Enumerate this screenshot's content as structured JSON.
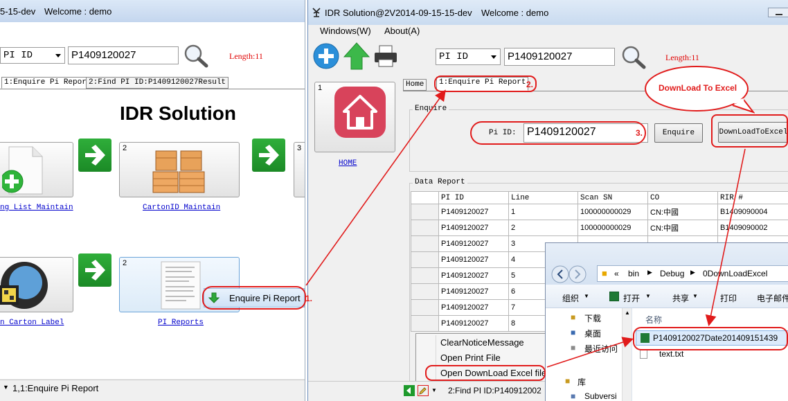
{
  "left_window": {
    "title_fragment": "5-15-dev",
    "welcome": "Welcome : demo",
    "combo_value": "PI ID",
    "pi_input_value": "P1409120027",
    "length_label": "Length:11",
    "tabs": [
      "1:Enquire Pi Report",
      "2:Find PI ID:P1409120027Result"
    ],
    "heading": "IDR Solution",
    "tile_numbers": [
      "2",
      "3",
      "2"
    ],
    "tile_links": [
      "ng List Maintain",
      "CartonID Maintain",
      "n Carton Label",
      "PI Reports"
    ],
    "popup_label": "Enquire Pi Report",
    "status_text": "1,1:Enquire Pi Report"
  },
  "right_window": {
    "title": "IDR Solution@2V2014-09-15-15-dev",
    "welcome": "Welcome : demo",
    "menu": [
      "Windows(W)",
      "About(A)"
    ],
    "combo_value": "PI ID",
    "pi_input_value": "P1409120027",
    "length_label": "Length:11",
    "tile_number": "1",
    "home_link": "HOME",
    "tabs": [
      "Home",
      "1:Enquire Pi Report"
    ],
    "enquire_group": "Enquire",
    "pi_id_label": "Pi ID:",
    "pi_id_value": "P1409120027",
    "enquire_button": "Enquire",
    "download_button": "DownLoadToExcel",
    "download_bubble": "DownLoad To Excel",
    "data_report_group": "Data Report",
    "grid": {
      "columns": [
        "PI ID",
        "Line",
        "Scan SN",
        "CO",
        "RIR #"
      ],
      "rows": [
        [
          "P1409120027",
          "1",
          "100000000029",
          "CN:中國",
          "B1409090004"
        ],
        [
          "P1409120027",
          "2",
          "100000000029",
          "CN:中國",
          "B1409090002"
        ],
        [
          "P1409120027",
          "3",
          "",
          "",
          ""
        ],
        [
          "P1409120027",
          "4",
          "",
          "",
          ""
        ],
        [
          "P1409120027",
          "5",
          "",
          "",
          ""
        ],
        [
          "P1409120027",
          "6",
          "",
          "",
          ""
        ],
        [
          "P1409120027",
          "7",
          "",
          "",
          ""
        ],
        [
          "P1409120027",
          "8",
          "",
          "",
          ""
        ]
      ]
    },
    "context_menu": [
      "ClearNoticeMessage",
      "Open Print File",
      "Open DownLoad Excel file"
    ],
    "status_text": "2:Find PI ID:P140912002"
  },
  "explorer": {
    "breadcrumb": [
      "bin",
      "Debug",
      "0DownLoadExcel"
    ],
    "toolbar": [
      "组织",
      "打开",
      "共享",
      "打印",
      "电子邮件"
    ],
    "nav_items": [
      "下载",
      "桌面",
      "最近访问",
      "库",
      "Subversi"
    ],
    "column_header": "名称",
    "files": [
      "P1409120027Date201409151439",
      "text.txt"
    ]
  },
  "annotations": [
    "1.",
    "2.",
    "3."
  ],
  "colors": {
    "annotation_red": "#e11b1b",
    "link_blue": "#0000cc",
    "green_arrow": "#1f9a2c"
  }
}
